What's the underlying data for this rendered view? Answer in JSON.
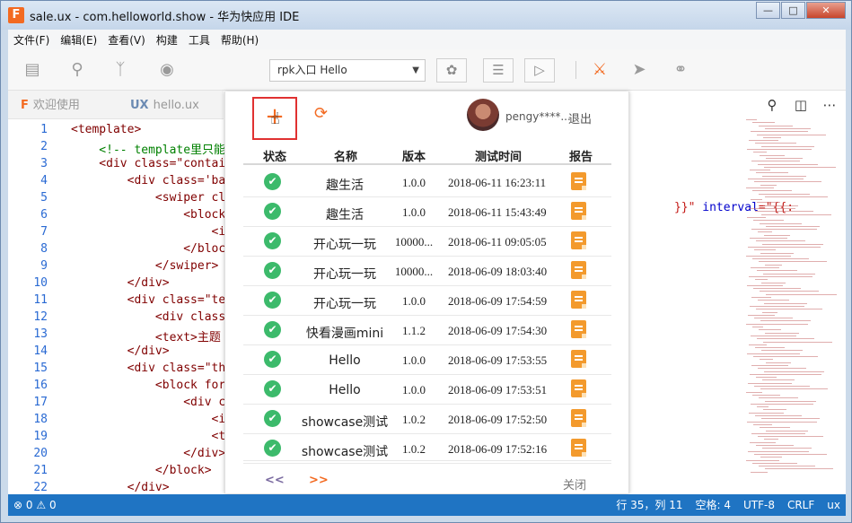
{
  "window": {
    "title": "sale.ux - com.helloworld.show - 华为快应用 IDE",
    "app_icon": "F"
  },
  "menu": [
    "文件(F)",
    "编辑(E)",
    "查看(V)",
    "构建",
    "工具",
    "帮助(H)"
  ],
  "toolbar": {
    "entry_value": "rpk入口 Hello"
  },
  "tabs": [
    {
      "icon": "F",
      "label": "欢迎使用"
    },
    {
      "icon": "UX",
      "label": "hello.ux"
    }
  ],
  "editor": {
    "line_numbers": [
      "1",
      "2",
      "3",
      "4",
      "5",
      "6",
      "7",
      "8",
      "9",
      "10",
      "11",
      "12",
      "13",
      "14",
      "15",
      "16",
      "17",
      "18",
      "19",
      "20",
      "21",
      "22"
    ],
    "lines": [
      {
        "text": "<template>",
        "type": "tag"
      },
      {
        "text": "    <!-- template里只能",
        "type": "comment"
      },
      {
        "text": "    <div class=\"contai",
        "type": "tag"
      },
      {
        "text": "        <div class='ba",
        "type": "tag"
      },
      {
        "text": "            <swiper cl",
        "type": "tag"
      },
      {
        "text": "                <block",
        "type": "tag"
      },
      {
        "text": "                    <i",
        "type": "tag"
      },
      {
        "text": "                </bloc",
        "type": "tag"
      },
      {
        "text": "            </swiper>",
        "type": "tag"
      },
      {
        "text": "        </div>",
        "type": "tag"
      },
      {
        "text": "        <div class=\"te",
        "type": "tag"
      },
      {
        "text": "            <div class",
        "type": "tag"
      },
      {
        "text": "            <text>主题",
        "type": "tag"
      },
      {
        "text": "        </div>",
        "type": "tag"
      },
      {
        "text": "        <div class=\"th",
        "type": "tag"
      },
      {
        "text": "            <block for",
        "type": "tag"
      },
      {
        "text": "                <div c",
        "type": "tag"
      },
      {
        "text": "                    <i",
        "type": "tag"
      },
      {
        "text": "                    <t",
        "type": "tag"
      },
      {
        "text": "                </div>",
        "type": "tag"
      },
      {
        "text": "            </block>",
        "type": "tag"
      },
      {
        "text": "        </div>",
        "type": "tag"
      }
    ],
    "right_fragment_a": "}}\" ",
    "right_fragment_b": "interval",
    "right_fragment_c": "=\"{{:"
  },
  "panel": {
    "user_name": "pengy****...",
    "logout_label": "退出",
    "columns": [
      "状态",
      "名称",
      "版本",
      "测试时间",
      "报告"
    ],
    "rows": [
      {
        "name": "趣生活",
        "version": "1.0.0",
        "time": "2018-06-11 16:23:11"
      },
      {
        "name": "趣生活",
        "version": "1.0.0",
        "time": "2018-06-11 15:43:49"
      },
      {
        "name": "开心玩一玩",
        "version": "10000...",
        "time": "2018-06-11 09:05:05"
      },
      {
        "name": "开心玩一玩",
        "version": "10000...",
        "time": "2018-06-09 18:03:40"
      },
      {
        "name": "开心玩一玩",
        "version": "1.0.0",
        "time": "2018-06-09 17:54:59"
      },
      {
        "name": "快看漫画mini",
        "version": "1.1.2",
        "time": "2018-06-09 17:54:30"
      },
      {
        "name": "Hello",
        "version": "1.0.0",
        "time": "2018-06-09 17:53:55"
      },
      {
        "name": "Hello",
        "version": "1.0.0",
        "time": "2018-06-09 17:53:51"
      },
      {
        "name": "showcase测试",
        "version": "1.0.2",
        "time": "2018-06-09 17:52:50"
      },
      {
        "name": "showcase测试",
        "version": "1.0.2",
        "time": "2018-06-09 17:52:16"
      }
    ],
    "prev_label": "<<",
    "next_label": ">>",
    "close_label": "关闭"
  },
  "status": {
    "errors": "0",
    "warnings": "0",
    "position": "行 35，列 11",
    "indent": "空格: 4",
    "encoding": "UTF-8",
    "eol": "CRLF",
    "language": "ux"
  },
  "colors": {
    "accent": "#f36a21",
    "status_bar": "#1f74c3",
    "success": "#3cba6b",
    "highlight_border": "#e03131"
  }
}
